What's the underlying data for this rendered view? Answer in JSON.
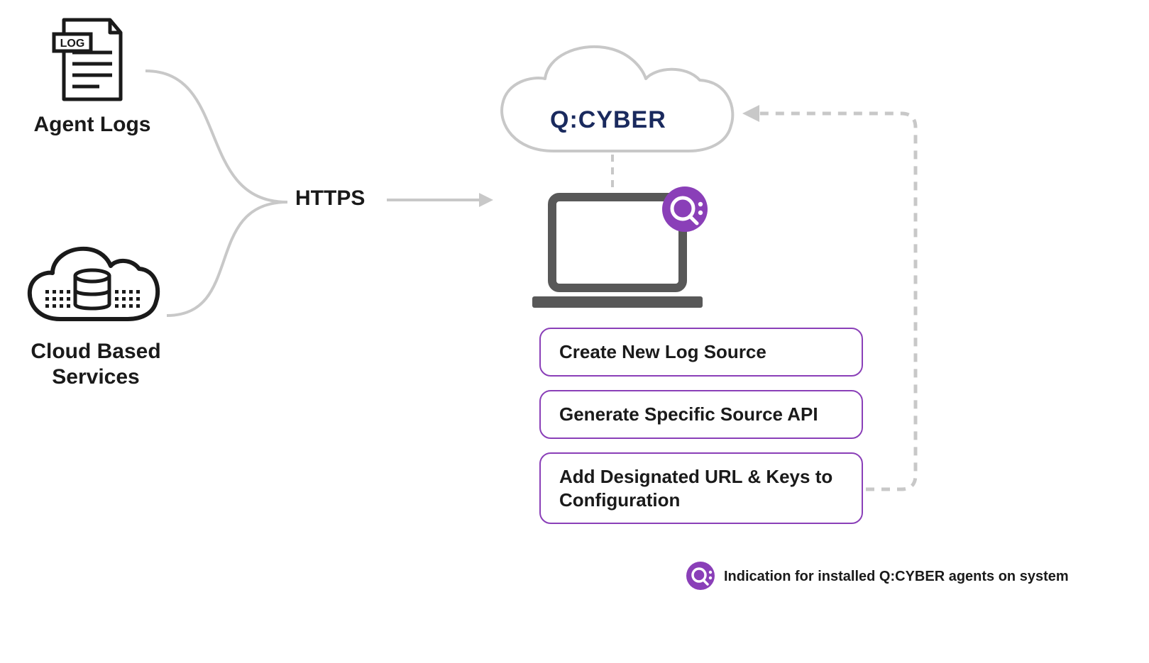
{
  "left": {
    "agent_logs_label": "Agent Logs",
    "cloud_services_label": "Cloud Based\nServices"
  },
  "center": {
    "https_label": "HTTPS",
    "cloud_brand": "Q:CYBER"
  },
  "steps": [
    {
      "label": "Create New Log Source"
    },
    {
      "label": "Generate Specific Source API"
    },
    {
      "label": "Add Designated URL & Keys to Configuration"
    }
  ],
  "legend": {
    "text": "Indication for installed Q:CYBER agents on system"
  },
  "colors": {
    "purple": "#8a3fb8",
    "navy": "#1a2a5e",
    "gray_stroke": "#bdbdbd",
    "dark_gray": "#585858",
    "black": "#1a1a1a"
  }
}
